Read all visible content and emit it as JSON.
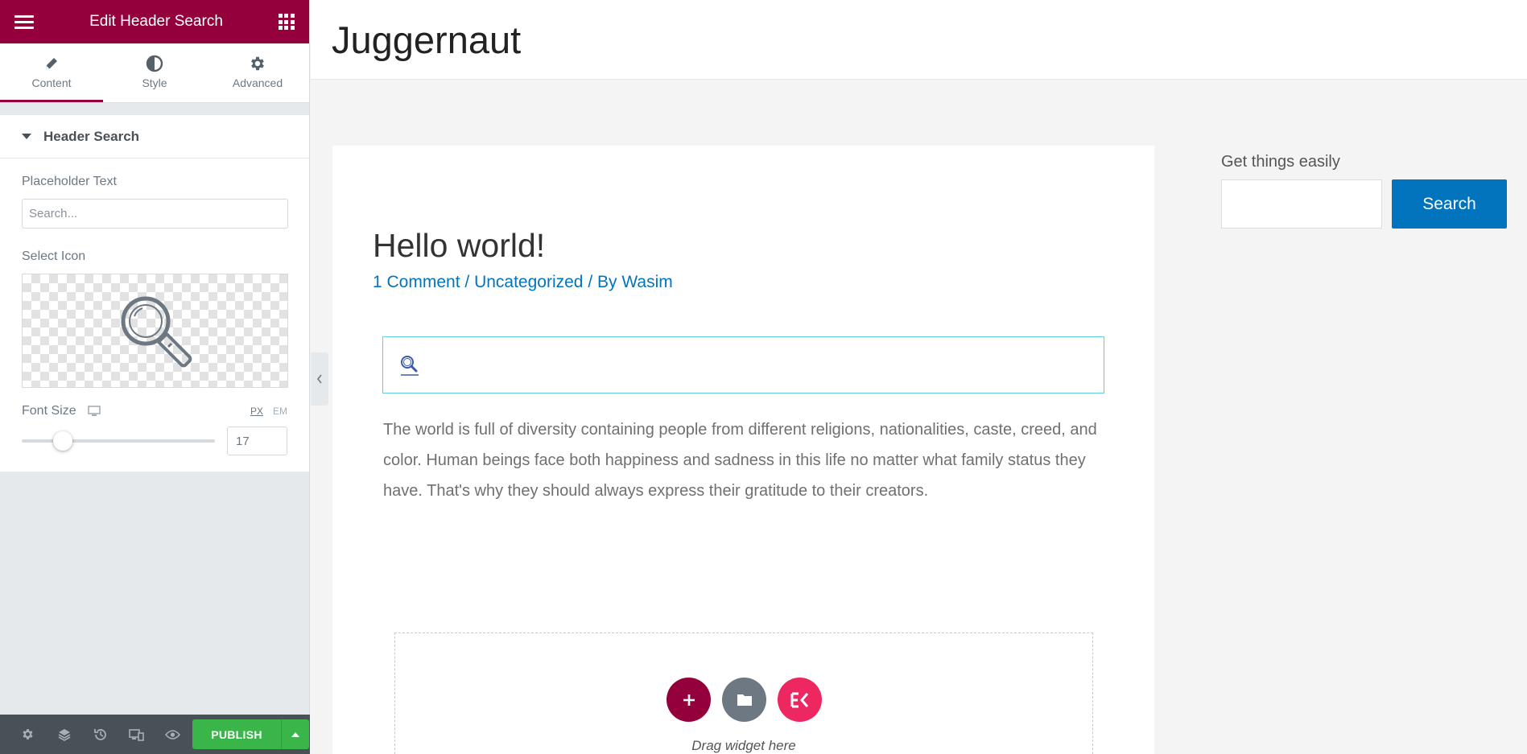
{
  "panel": {
    "title": "Edit Header Search",
    "tabs": [
      {
        "label": "Content",
        "icon": "pencil-icon"
      },
      {
        "label": "Style",
        "icon": "half-circle-icon"
      },
      {
        "label": "Advanced",
        "icon": "gear-icon"
      }
    ],
    "section_title": "Header Search",
    "placeholder_label": "Placeholder Text",
    "placeholder_value": "Search...",
    "icon_label": "Select Icon",
    "font_size_label": "Font Size",
    "unit_px": "PX",
    "unit_em": "EM",
    "font_size_value": "17",
    "font_size_slider_fraction": 0.17,
    "publish_label": "PUBLISH",
    "accent_color": "#93003c",
    "publish_color": "#39b54a"
  },
  "preview": {
    "site_title": "Juggernaut",
    "post_title": "Hello world!",
    "meta": {
      "comments": "1 Comment",
      "sep1": "/",
      "category": "Uncategorized",
      "sep2": "/ By",
      "author": "Wasim"
    },
    "body": "The world is full of diversity containing people from different religions, nationalities, caste, creed, and color. Human beings face both happiness and sadness in this life no matter what family status they have. That's why they should always express their gratitude to their creators.",
    "drop_label": "Drag widget here",
    "sidebar_label": "Get things easily",
    "sidebar_button": "Search",
    "link_color": "#0274be"
  }
}
